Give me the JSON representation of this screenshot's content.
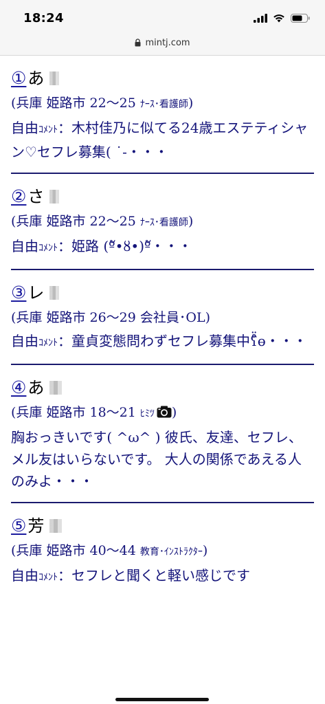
{
  "status": {
    "time": "18:24",
    "icons": [
      "signal-icon",
      "wifi-icon",
      "battery-icon"
    ]
  },
  "browser": {
    "url": "mintj.com"
  },
  "entries": [
    {
      "num": "①",
      "name": "あ",
      "meta_prefix": "(兵庫 姫路市 22〜25 ",
      "meta_job": "ﾅｰｽ･看護師",
      "meta_suffix": ")",
      "comment_label": "自由",
      "comment_label_half": "ｺﾒﾝﾄ",
      "comment_text": "：木村佳乃に似てる24歳エステティシャン♡セフレ募集(   ˙-・・・"
    },
    {
      "num": "②",
      "name": "さ",
      "meta_prefix": "(兵庫 姫路市 22〜25 ",
      "meta_job": "ﾅｰｽ･看護師",
      "meta_suffix": ")",
      "comment_label": "自由",
      "comment_label_half": "ｺﾒﾝﾄ",
      "comment_text": "：姫路 (ºั•ȣ•)ºั・・・"
    },
    {
      "num": "③",
      "name": "レ",
      "meta_prefix": "(兵庫 姫路市 26〜29 ",
      "meta_job": "会社員･OL",
      "meta_suffix": ")",
      "comment_label": "自由",
      "comment_label_half": "ｺﾒﾝﾄ",
      "comment_text": "：童貞変態問わずセフレ募集中ʕ̊̈ө・・・"
    },
    {
      "num": "④",
      "name": "あ",
      "meta_prefix": "(兵庫 姫路市 18〜21 ",
      "meta_job": "ﾋﾐﾂ",
      "meta_suffix": ")",
      "comment_label": "",
      "comment_label_half": "",
      "comment_text": "胸おっきいです( ^ω^ ) 彼氏、友達、セフレ、メル友はいらないです。 大人の関係であえる人のみよ・・・"
    },
    {
      "num": "⑤",
      "name": "芳",
      "meta_prefix": "(兵庫 姫路市 40〜44 ",
      "meta_job": "教育･ｲﾝｽﾄﾗｸﾀｰ",
      "meta_suffix": ")",
      "comment_label": "自由",
      "comment_label_half": "ｺﾒﾝﾄ",
      "comment_text": "：セフレと聞くと軽い感じです"
    }
  ],
  "colors": {
    "link": "#1a1a9e",
    "text": "#14147a",
    "divider": "#1a1a6e"
  }
}
